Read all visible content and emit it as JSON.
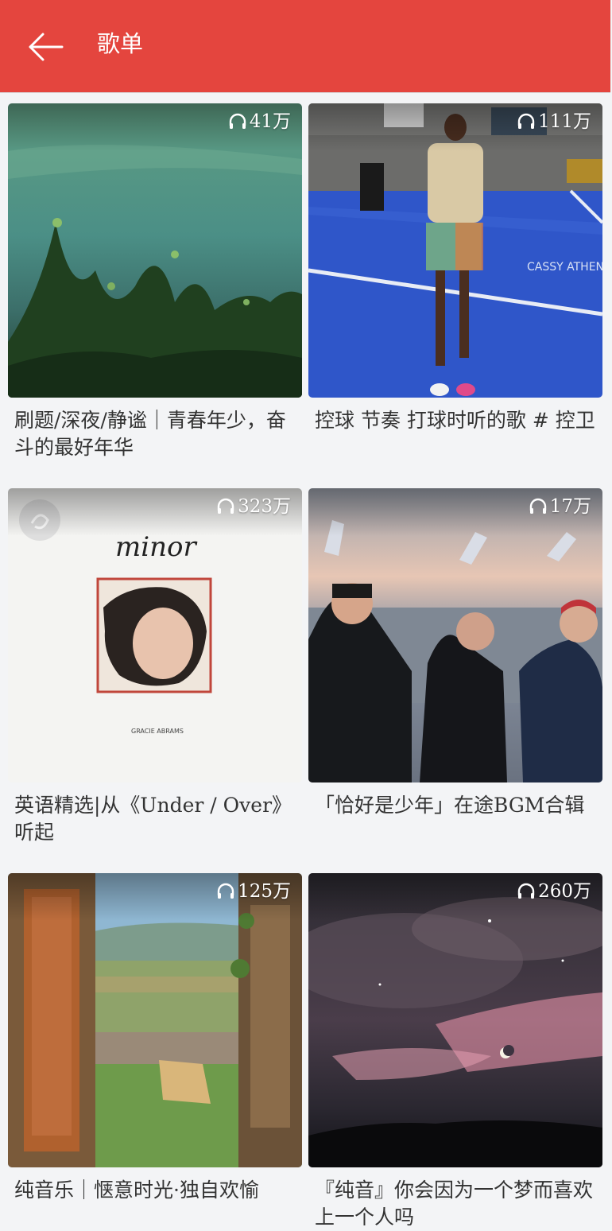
{
  "header": {
    "title": "歌单",
    "back_icon": "arrow-left-icon",
    "color": "#e4453e"
  },
  "playlists": [
    {
      "name": "刷题/深夜/静谧｜青春年少，奋斗的最好年华",
      "play_count": "41万"
    },
    {
      "name": "控球 节奏 打球时听的歌 # 控卫",
      "play_count": "111万",
      "cover_text": "CASSY ATHENA"
    },
    {
      "name": "英语精选|从《Under / Over》听起",
      "play_count": "323万",
      "cover_text": "minor",
      "cover_small_text": "GRACIE ABRAMS"
    },
    {
      "name": "「恰好是少年」在途BGM合辑",
      "play_count": "17万"
    },
    {
      "name": "纯音乐｜惬意时光·独自欢愉",
      "play_count": "125万"
    },
    {
      "name": "『纯音』你会因为一个梦而喜欢上一个人吗",
      "play_count": "260万"
    }
  ]
}
